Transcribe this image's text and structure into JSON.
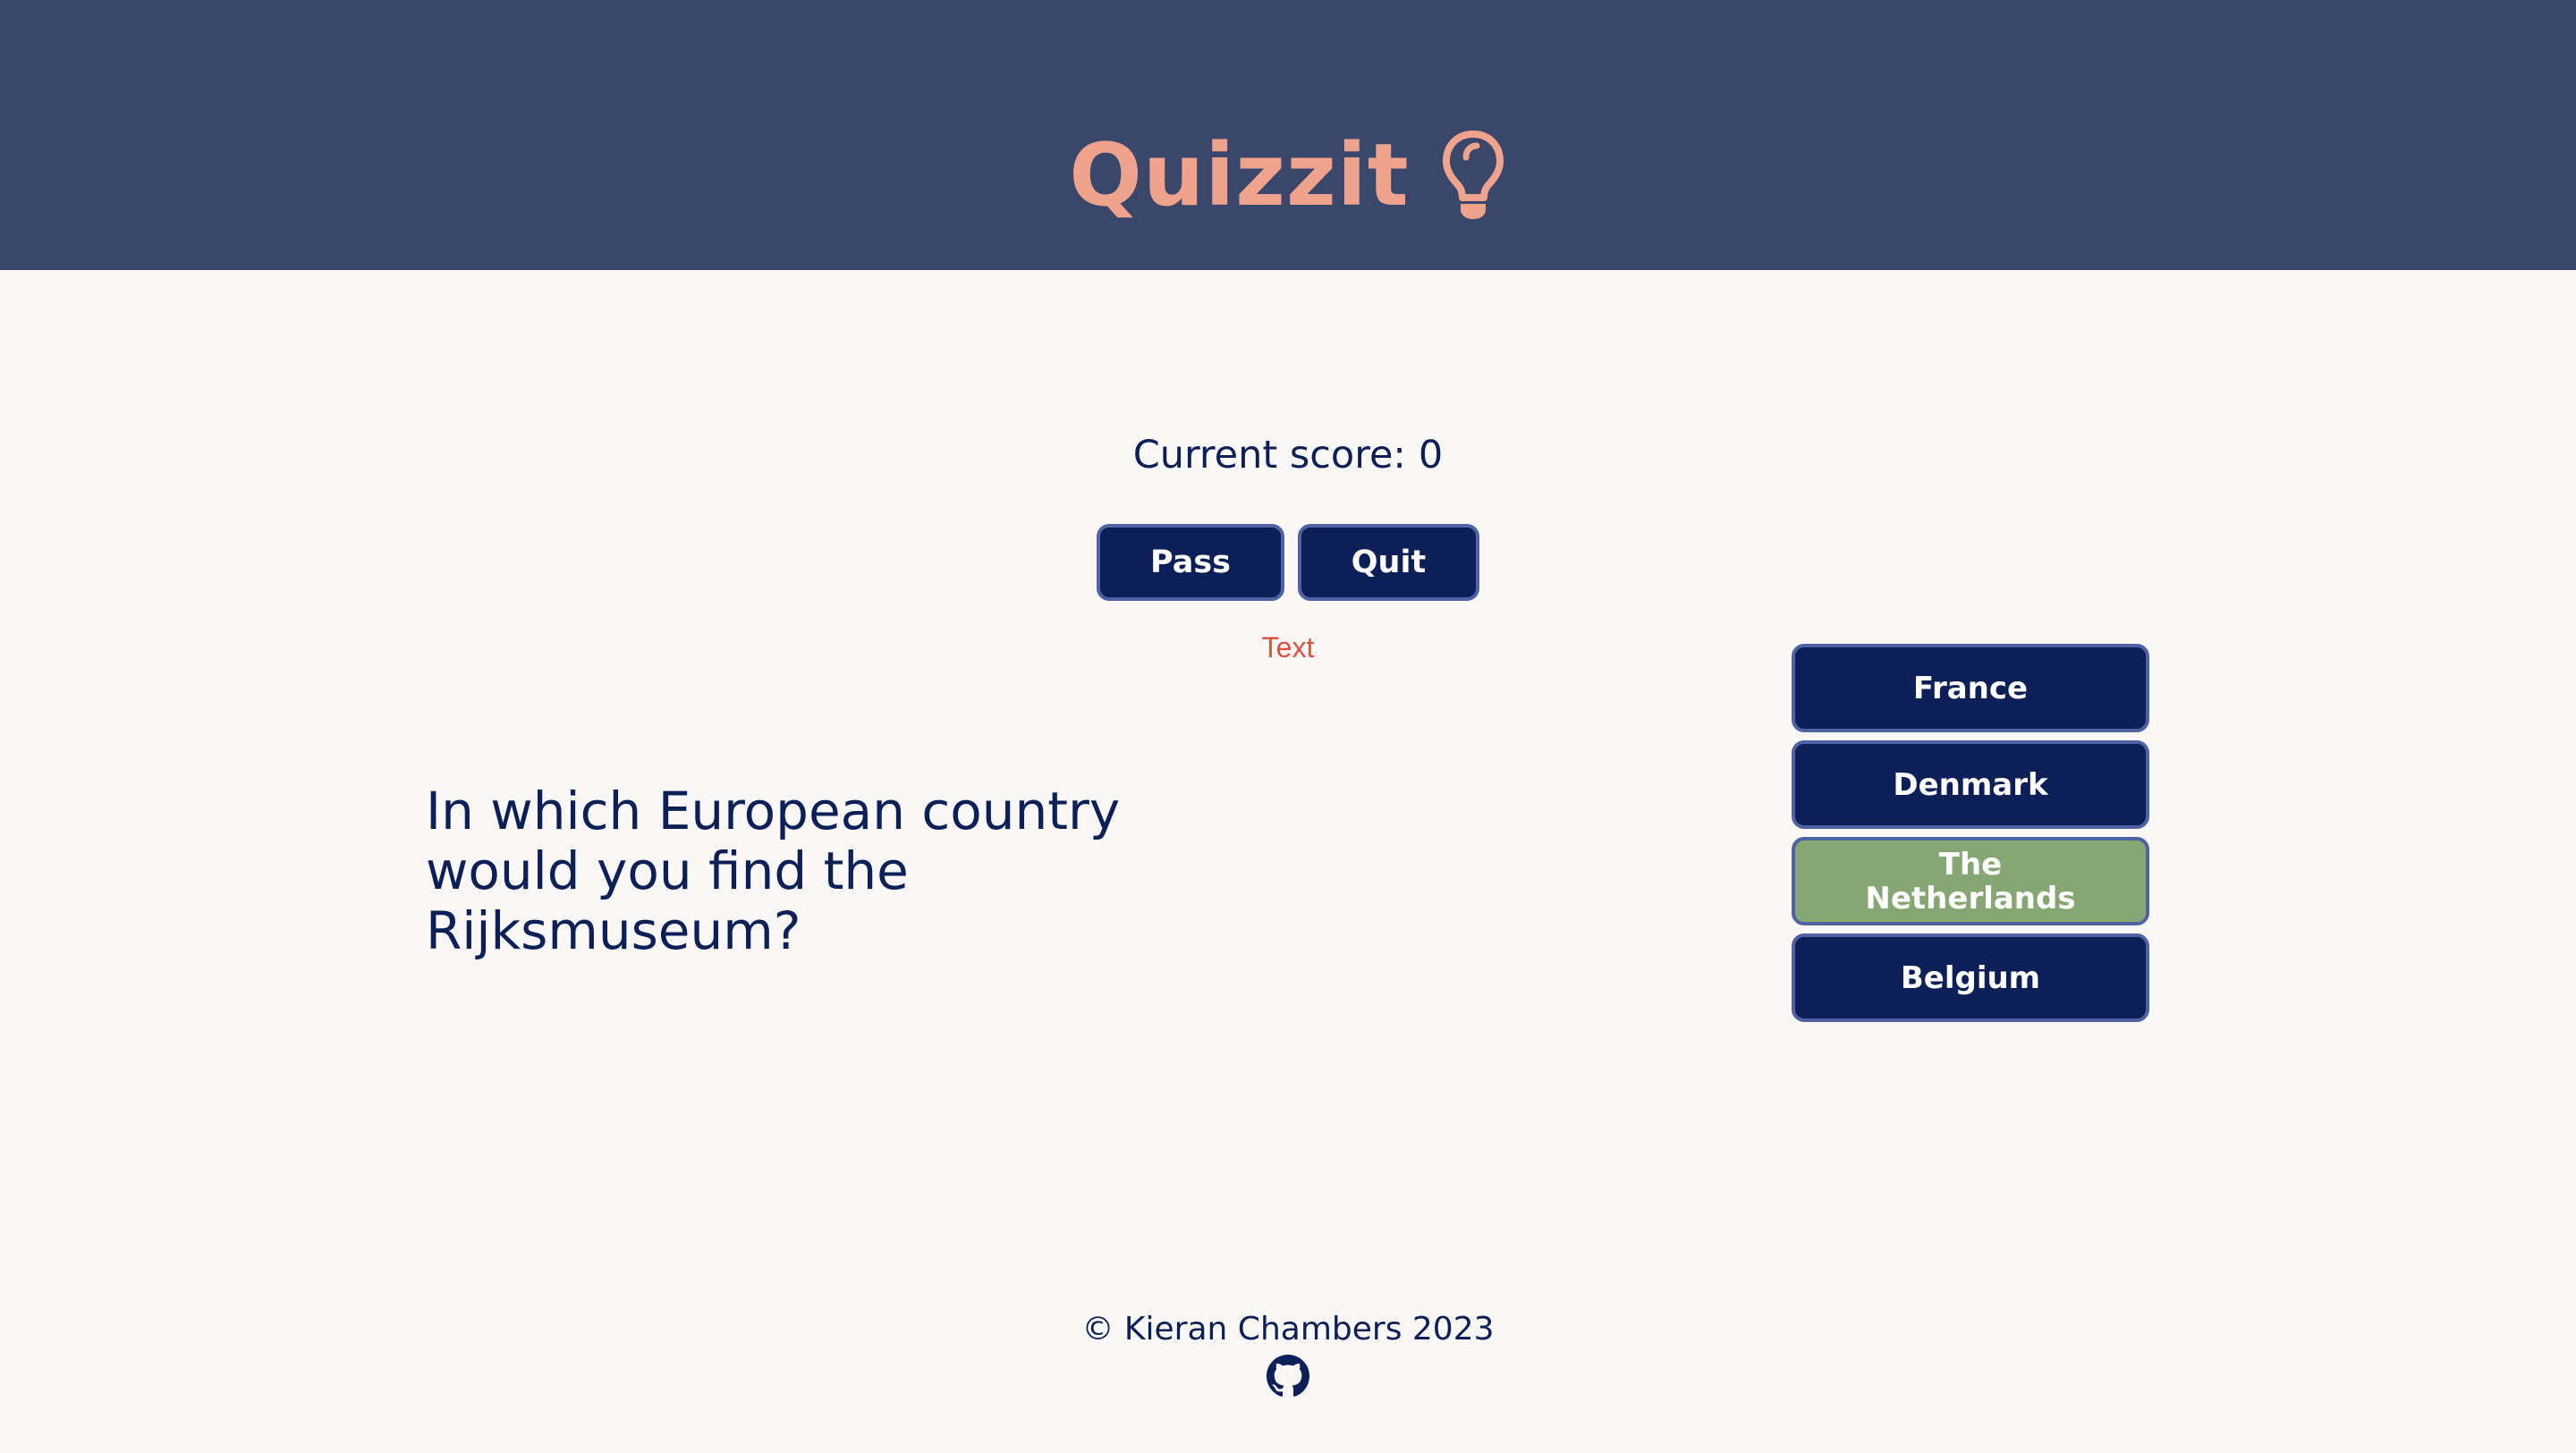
{
  "header": {
    "title": "Quizzit",
    "icon": "lightbulb-icon",
    "background": "#3b466b",
    "accent": "#f0a38c"
  },
  "score": {
    "label": "Current score:",
    "value": "0"
  },
  "controls": {
    "pass_label": "Pass",
    "quit_label": "Quit"
  },
  "feedback": {
    "text": "Text",
    "color": "#d9533f"
  },
  "question": {
    "text": "In which European country would you find the Rijksmuseum?"
  },
  "answers": [
    {
      "label": "France",
      "state": "default"
    },
    {
      "label": "Denmark",
      "state": "default"
    },
    {
      "label": "The Netherlands",
      "state": "correct"
    },
    {
      "label": "Belgium",
      "state": "default"
    }
  ],
  "colors": {
    "button": "#0c1f57",
    "correct": "#86a774",
    "text": "#0c1f57",
    "page_background": "#f9f8f6"
  },
  "footer": {
    "copyright": "© Kieran Chambers 2023",
    "icon": "github-icon"
  }
}
